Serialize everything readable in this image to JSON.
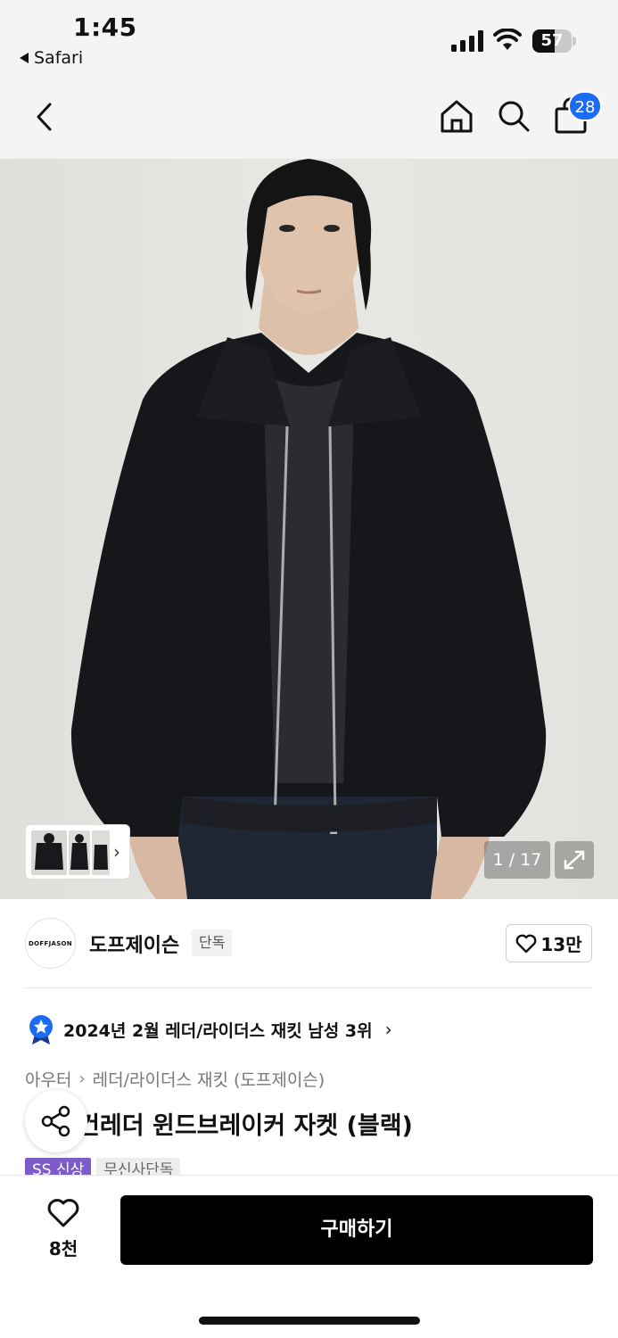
{
  "status_bar": {
    "time": "1:45",
    "back_app": "Safari",
    "battery_level": "57",
    "battery_fraction": 0.57
  },
  "nav": {
    "back_icon": "chevron-left-icon",
    "home_icon": "home-icon",
    "search_icon": "search-icon",
    "cart_icon": "shopping-bag-icon",
    "cart_count": "28",
    "badge_color": "#1b6cf2"
  },
  "gallery": {
    "counter": "1 / 17",
    "expand_icon": "expand-icon"
  },
  "brand": {
    "logo_text": "DOFFJASON",
    "name": "도프제이슨",
    "exclusive_tag": "단독",
    "like_count": "13만"
  },
  "ranking": {
    "text": "2024년 2월 레더/라이더스 재킷 남성 3위",
    "icon": "medal-icon"
  },
  "breadcrumb": {
    "items": [
      "아우터",
      "레더/라이더스 재킷 (도프제이슨)"
    ]
  },
  "product": {
    "title": "핏 비건레더 윈드브레이커 자켓 (블랙)",
    "tags": [
      "SS 신상",
      "무신사단독"
    ],
    "tag_color": "#7b5cc8"
  },
  "bottom_bar": {
    "wish_count": "8천",
    "buy_label": "구매하기"
  }
}
